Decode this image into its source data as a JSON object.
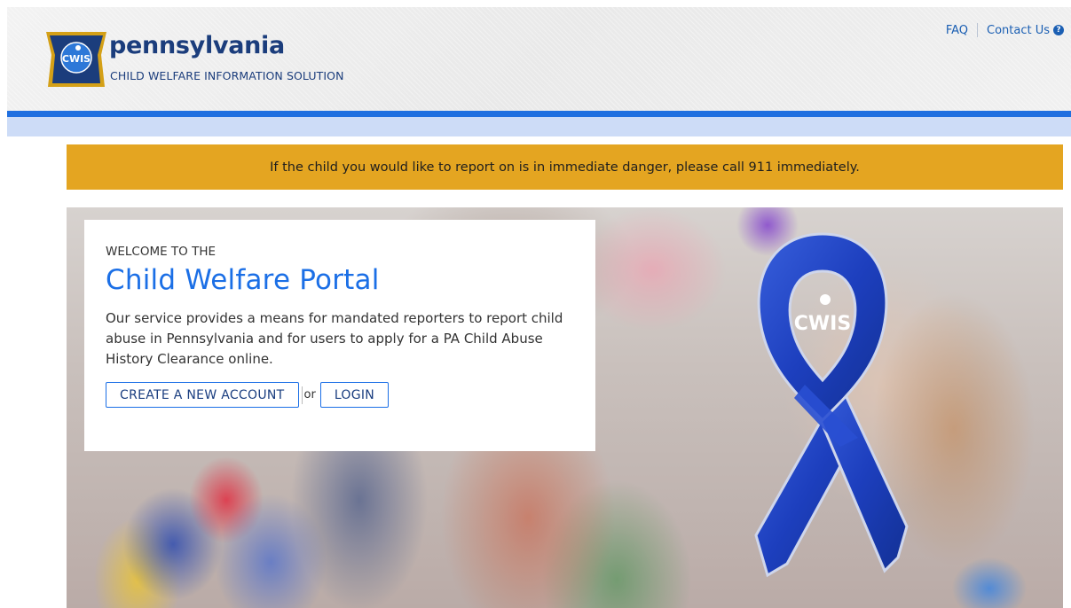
{
  "header": {
    "brand_name": "pennsylvania",
    "brand_subtitle": "CHILD WELFARE INFORMATION SOLUTION",
    "logo_text": "CWIS",
    "links": {
      "faq": "FAQ",
      "contact": "Contact Us"
    }
  },
  "alert": {
    "message": "If the child you would like to report on is in immediate danger, please call 911 immediately."
  },
  "hero": {
    "eyebrow": "WELCOME TO THE",
    "title": "Child Welfare Portal",
    "description": "Our service provides a means for mandated reporters to report child abuse in Pennsylvania and for users to apply for a PA Child Abuse History Clearance online.",
    "create_account_label": "CREATE A NEW ACCOUNT",
    "or_label": "or",
    "login_label": "LOGIN",
    "ribbon_text": "CWIS"
  },
  "colors": {
    "brand_navy": "#1b3d7c",
    "accent_blue": "#1f6fe0",
    "alert_gold": "#e4a521",
    "light_bar": "#cddcf7"
  },
  "icons": {
    "help": "question-circle-icon",
    "logo": "keystone-logo-icon",
    "ribbon": "awareness-ribbon-icon"
  }
}
